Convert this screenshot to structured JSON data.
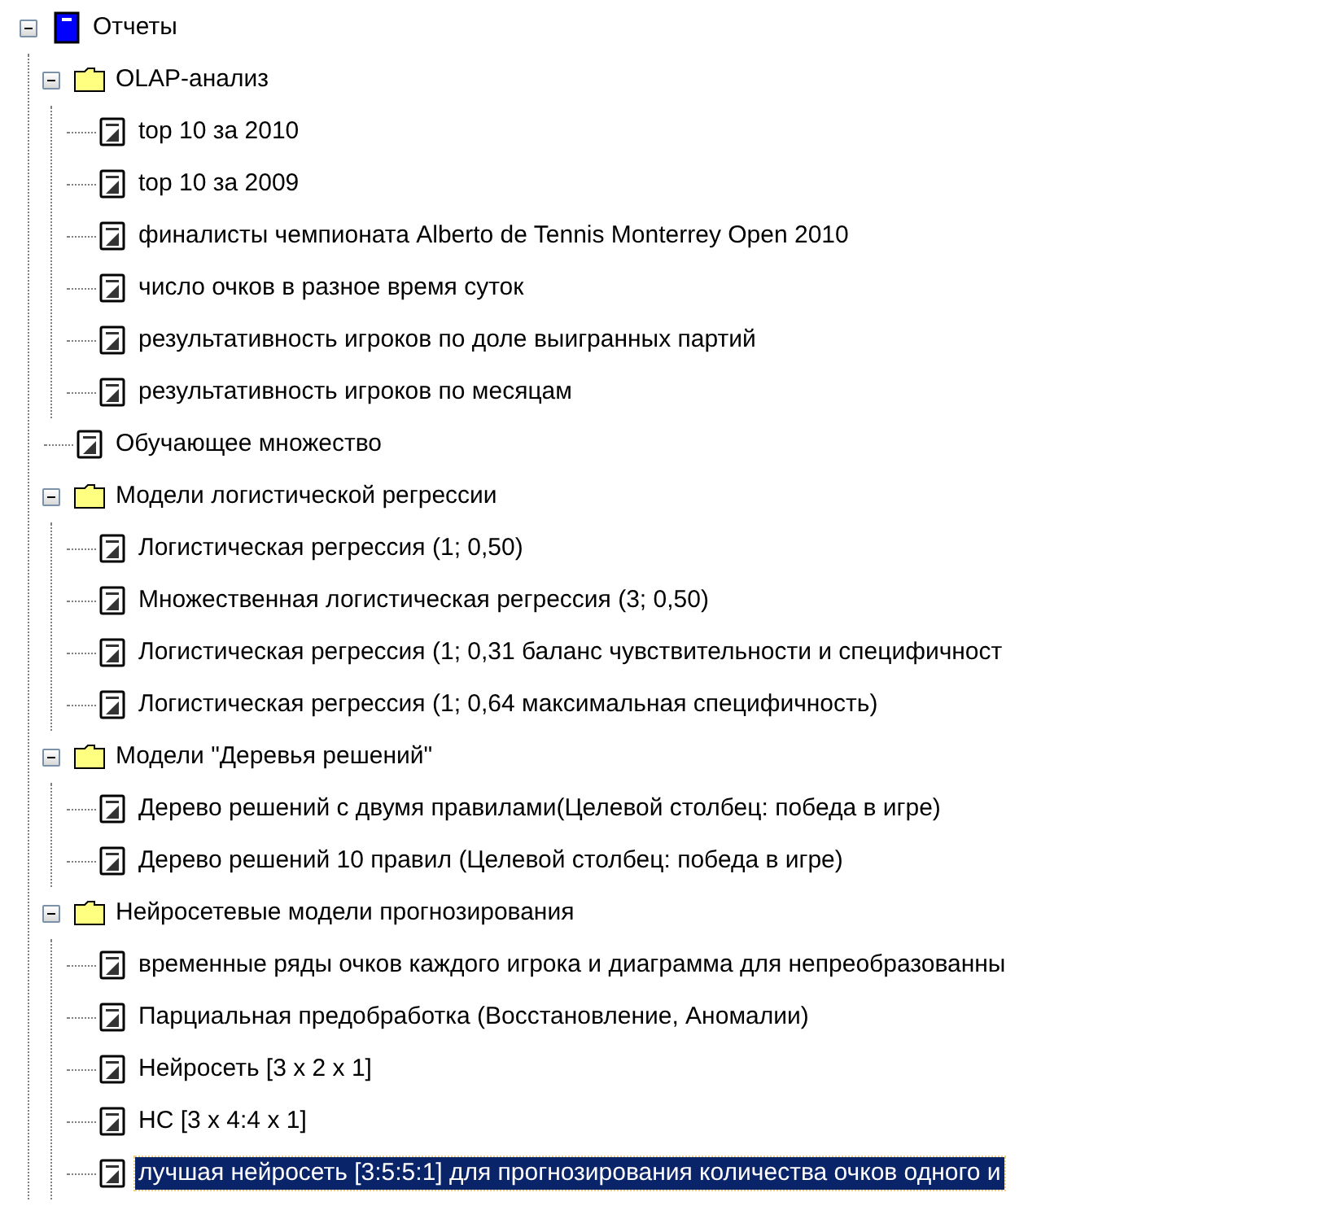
{
  "tree": [
    {
      "kind": "root",
      "label": "Отчеты",
      "expanded": true,
      "selected": false,
      "children": [
        {
          "kind": "folder",
          "label": "OLAP-анализ",
          "expanded": true,
          "selected": false,
          "children": [
            {
              "kind": "report",
              "label": "top 10 за 2010",
              "selected": false
            },
            {
              "kind": "report",
              "label": "top 10 за 2009",
              "selected": false
            },
            {
              "kind": "report",
              "label": "финалисты чемпионата Alberto de Tennis Monterrey Open 2010",
              "selected": false
            },
            {
              "kind": "report",
              "label": "число очков в разное время суток",
              "selected": false
            },
            {
              "kind": "report",
              "label": "результативность игроков по доле выигранных партий",
              "selected": false
            },
            {
              "kind": "report",
              "label": "результативность игроков по месяцам",
              "selected": false
            }
          ]
        },
        {
          "kind": "report",
          "label": "Обучающее множество",
          "selected": false
        },
        {
          "kind": "folder",
          "label": "Модели логистической регрессии",
          "expanded": true,
          "selected": false,
          "children": [
            {
              "kind": "report",
              "label": "Логистическая регрессия (1; 0,50)",
              "selected": false
            },
            {
              "kind": "report",
              "label": "Множественная логистическая регрессия (3; 0,50)",
              "selected": false
            },
            {
              "kind": "report",
              "label": "Логистическая регрессия (1; 0,31 баланс чувствительности и специфичност",
              "selected": false
            },
            {
              "kind": "report",
              "label": "Логистическая регрессия (1; 0,64 максимальная специфичность)",
              "selected": false
            }
          ]
        },
        {
          "kind": "folder",
          "label": "Модели \"Деревья решений\"",
          "expanded": true,
          "selected": false,
          "children": [
            {
              "kind": "report",
              "label": "Дерево решений с двумя правилами(Целевой столбец: победа в игре)",
              "selected": false
            },
            {
              "kind": "report",
              "label": "Дерево решений 10 правил (Целевой столбец: победа в игре)",
              "selected": false
            }
          ]
        },
        {
          "kind": "folder",
          "label": "Нейросетевые модели прогнозирования",
          "expanded": true,
          "selected": false,
          "children": [
            {
              "kind": "report",
              "label": "временные ряды очков каждого игрока и диаграмма для непреобразованны",
              "selected": false
            },
            {
              "kind": "report",
              "label": "Парциальная предобработка (Восстановление, Аномалии)",
              "selected": false
            },
            {
              "kind": "report",
              "label": "Нейросеть [3 x 2 x 1]",
              "selected": false
            },
            {
              "kind": "report",
              "label": "НС  [3 x 4:4 x 1]",
              "selected": false
            },
            {
              "kind": "report",
              "label": "лучшая нейросеть [3:5:5:1] для прогнозирования количества очков одного и",
              "selected": true
            }
          ]
        }
      ]
    }
  ]
}
